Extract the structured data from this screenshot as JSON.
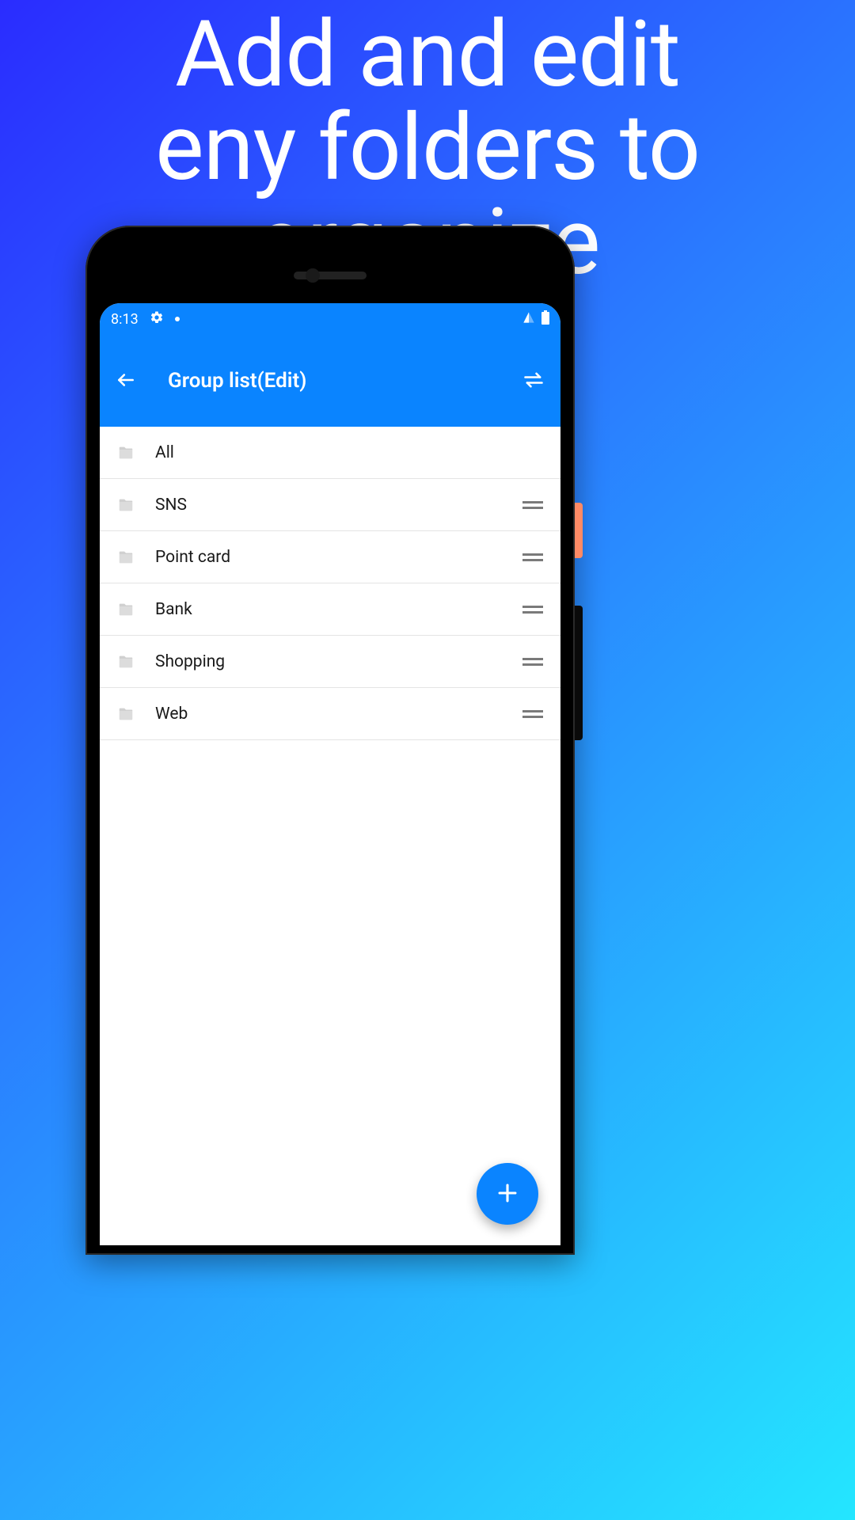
{
  "promo": {
    "headline": "Add and edit\neny folders to\norganize"
  },
  "statusbar": {
    "time": "8:13"
  },
  "appbar": {
    "title": "Group list(Edit)"
  },
  "list": {
    "items": [
      {
        "label": "All",
        "draggable": false
      },
      {
        "label": "SNS",
        "draggable": true
      },
      {
        "label": "Point card",
        "draggable": true
      },
      {
        "label": "Bank",
        "draggable": true
      },
      {
        "label": "Shopping",
        "draggable": true
      },
      {
        "label": "Web",
        "draggable": true
      }
    ]
  },
  "colors": {
    "accent": "#0a84ff"
  }
}
